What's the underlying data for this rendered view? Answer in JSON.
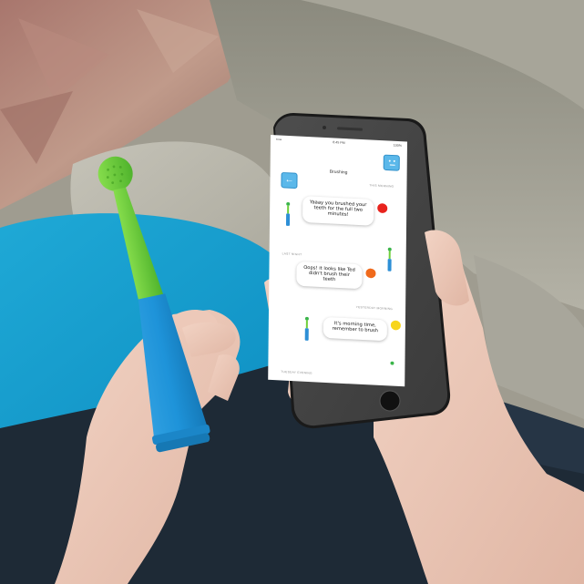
{
  "status_bar": {
    "carrier": "•••••",
    "time": "8:45 PM",
    "battery": "100%"
  },
  "app": {
    "title": "Brushing",
    "back_icon": "arrow-left-icon",
    "avatar_icon": "face-icon"
  },
  "feed": [
    {
      "section": "THIS MORNING",
      "message": "Yaaay you brushed your teeth for the full two minutes!",
      "status_color": "#e8231d"
    },
    {
      "section": "LAST NIGHT",
      "message": "Oops! it looks like Ted didn't brush their teeth",
      "status_color": "#f06a1c"
    },
    {
      "section": "YESTERDAY MORNING",
      "message": "It's morning time, remember to brush",
      "status_color": "#f7d51b"
    }
  ],
  "footer_section": "TUESDAY EVENING",
  "colors": {
    "brush_green": "#6fcf3a",
    "brush_blue": "#1e93d9",
    "app_accent": "#5bb8ea"
  }
}
